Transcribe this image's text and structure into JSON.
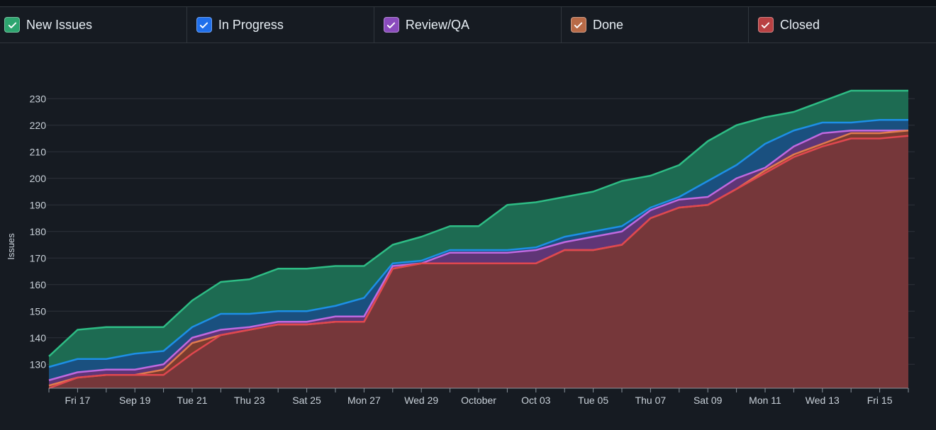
{
  "legend": {
    "items": [
      {
        "label": "New Issues",
        "color": "#2da56f"
      },
      {
        "label": "In Progress",
        "color": "#1f6feb"
      },
      {
        "label": "Review/QA",
        "color": "#8a4bbd"
      },
      {
        "label": "Done",
        "color": "#b86a47"
      },
      {
        "label": "Closed",
        "color": "#b94143"
      }
    ]
  },
  "chart_data": {
    "type": "area",
    "ylabel": "Issues",
    "xlabel": "",
    "ylim": [
      121,
      233
    ],
    "yticks": [
      130,
      140,
      150,
      160,
      170,
      180,
      190,
      200,
      210,
      220,
      230
    ],
    "grid": true,
    "x_tick_labels": [
      {
        "day": 1,
        "label": "Fri 17"
      },
      {
        "day": 3,
        "label": "Sep 19"
      },
      {
        "day": 5,
        "label": "Tue 21"
      },
      {
        "day": 7,
        "label": "Thu 23"
      },
      {
        "day": 9,
        "label": "Sat 25"
      },
      {
        "day": 11,
        "label": "Mon 27"
      },
      {
        "day": 13,
        "label": "Wed 29"
      },
      {
        "day": 15,
        "label": "October"
      },
      {
        "day": 17,
        "label": "Oct 03"
      },
      {
        "day": 19,
        "label": "Tue 05"
      },
      {
        "day": 21,
        "label": "Thu 07"
      },
      {
        "day": 23,
        "label": "Sat 09"
      },
      {
        "day": 25,
        "label": "Mon 11"
      },
      {
        "day": 27,
        "label": "Wed 13"
      },
      {
        "day": 29,
        "label": "Fri 15"
      }
    ],
    "series": [
      {
        "name": "New Issues",
        "color": "#2ebd85",
        "fill": "#1d6b52",
        "values": [
          133,
          143,
          144,
          144,
          144,
          154,
          161,
          162,
          166,
          166,
          167,
          167,
          175,
          178,
          182,
          182,
          190,
          191,
          193,
          195,
          199,
          201,
          205,
          214,
          220,
          223,
          225,
          229,
          233,
          233,
          233
        ]
      },
      {
        "name": "In Progress",
        "color": "#1d8fe6",
        "fill": "#1a507f",
        "values": [
          129,
          132,
          132,
          134,
          135,
          144,
          149,
          149,
          150,
          150,
          152,
          155,
          168,
          169,
          173,
          173,
          173,
          174,
          178,
          180,
          182,
          189,
          193,
          199,
          205,
          213,
          218,
          221,
          221,
          222,
          222
        ]
      },
      {
        "name": "Review/QA",
        "color": "#c069e0",
        "fill": "#5f3576",
        "values": [
          124,
          127,
          128,
          128,
          130,
          140,
          143,
          144,
          146,
          146,
          148,
          148,
          167,
          168,
          172,
          172,
          172,
          173,
          176,
          178,
          180,
          188,
          192,
          193,
          200,
          204,
          212,
          217,
          218,
          218,
          218
        ]
      },
      {
        "name": "Done",
        "color": "#e07a4e",
        "fill": "#7a3c2f",
        "values": [
          122,
          125,
          126,
          126,
          128,
          138,
          141,
          143,
          145,
          145,
          146,
          146,
          166,
          168,
          168,
          168,
          168,
          168,
          173,
          173,
          175,
          185,
          189,
          190,
          196,
          203,
          209,
          213,
          217,
          217,
          218
        ]
      },
      {
        "name": "Closed",
        "color": "#e0474f",
        "fill": "#76373a",
        "values": [
          121,
          125,
          126,
          126,
          126,
          134,
          141,
          143,
          145,
          145,
          146,
          146,
          166,
          168,
          168,
          168,
          168,
          168,
          173,
          173,
          175,
          185,
          189,
          190,
          196,
          202,
          208,
          212,
          215,
          215,
          216
        ]
      }
    ]
  }
}
